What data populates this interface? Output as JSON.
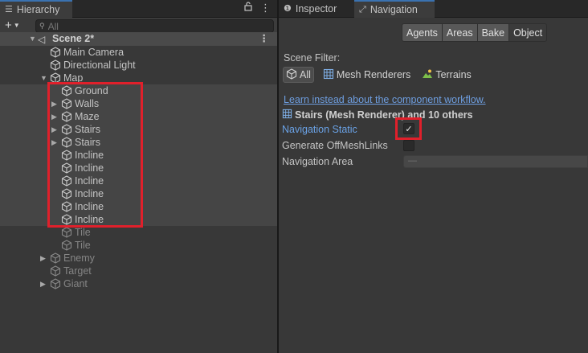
{
  "hierarchy": {
    "tab_label": "Hierarchy",
    "search_placeholder": "All",
    "scene_name": "Scene 2*",
    "items": [
      {
        "label": "Main Camera",
        "depth": 1,
        "expandable": false,
        "dim": false
      },
      {
        "label": "Directional Light",
        "depth": 1,
        "expandable": false,
        "dim": false
      },
      {
        "label": "Map",
        "depth": 1,
        "expandable": true,
        "expanded": true,
        "dim": false
      },
      {
        "label": "Ground",
        "depth": 2,
        "expandable": false,
        "dim": false
      },
      {
        "label": "Walls",
        "depth": 2,
        "expandable": true,
        "dim": false
      },
      {
        "label": "Maze",
        "depth": 2,
        "expandable": true,
        "dim": false
      },
      {
        "label": "Stairs",
        "depth": 2,
        "expandable": true,
        "dim": false
      },
      {
        "label": "Stairs",
        "depth": 2,
        "expandable": true,
        "dim": false
      },
      {
        "label": "Incline",
        "depth": 2,
        "expandable": false,
        "dim": false
      },
      {
        "label": "Incline",
        "depth": 2,
        "expandable": false,
        "dim": false
      },
      {
        "label": "Incline",
        "depth": 2,
        "expandable": false,
        "dim": false
      },
      {
        "label": "Incline",
        "depth": 2,
        "expandable": false,
        "dim": false
      },
      {
        "label": "Incline",
        "depth": 2,
        "expandable": false,
        "dim": false
      },
      {
        "label": "Incline",
        "depth": 2,
        "expandable": false,
        "dim": false
      },
      {
        "label": "Tile",
        "depth": 2,
        "expandable": false,
        "dim": true
      },
      {
        "label": "Tile",
        "depth": 2,
        "expandable": false,
        "dim": true
      },
      {
        "label": "Enemy",
        "depth": 1,
        "expandable": true,
        "dim": true
      },
      {
        "label": "Target",
        "depth": 1,
        "expandable": false,
        "dim": true
      },
      {
        "label": "Giant",
        "depth": 1,
        "expandable": true,
        "dim": true
      }
    ]
  },
  "right": {
    "tabs": [
      {
        "label": "Inspector",
        "icon": "info-icon"
      },
      {
        "label": "Navigation",
        "icon": "navigation-icon"
      }
    ],
    "nav_buttons": [
      "Agents",
      "Areas",
      "Bake",
      "Object"
    ],
    "active_nav": "Object",
    "scene_filter_label": "Scene Filter:",
    "filters": [
      {
        "label": "All",
        "icon": "cube-icon"
      },
      {
        "label": "Mesh Renderers",
        "icon": "mesh-renderer-icon"
      },
      {
        "label": "Terrains",
        "icon": "terrain-icon"
      }
    ],
    "link_text": "Learn instead about the component workflow.",
    "selection_title": "Stairs (Mesh Renderer) and 10 others",
    "properties": {
      "navigation_static": {
        "label": "Navigation Static",
        "checked": true
      },
      "offmesh": {
        "label": "Generate OffMeshLinks",
        "checked": false
      },
      "area": {
        "label": "Navigation Area",
        "value": "—"
      }
    },
    "checkmark": "✓"
  },
  "colors": {
    "highlight": "#e0202b",
    "link": "#6e9ee0",
    "accent_tab": "#3a72b0"
  }
}
